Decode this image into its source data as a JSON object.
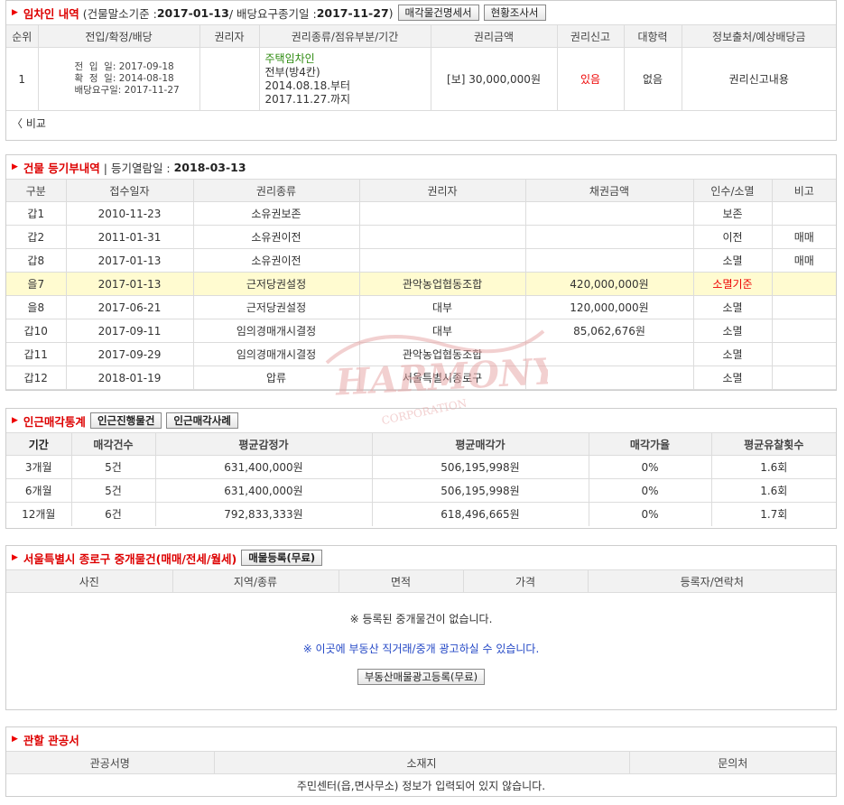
{
  "tenant": {
    "title": "임차인 내역",
    "sub_prefix": "(건물말소기준 : ",
    "base_date": "2017-01-13",
    "sub_mid": " / 배당요구종기일 : ",
    "deadline": "2017-11-27",
    "sub_suffix": ")",
    "btn1": "매각물건명세서",
    "btn2": "현황조사서",
    "headers": [
      "순위",
      "전입/확정/배당",
      "권리자",
      "권리종류/점유부분/기간",
      "권리금액",
      "권리신고",
      "대항력",
      "정보출처/예상배당금"
    ],
    "row": {
      "rank": "1",
      "dates": [
        "전  입  일: 2017-09-18",
        "확  정  일: 2014-08-18",
        "배당요구일: 2017-11-27"
      ],
      "holder": "",
      "right_type": "주택임차인",
      "right_lines": [
        "전부(방4칸)",
        "2014.08.18.부터",
        "2017.11.27.까지"
      ],
      "amount": "[보] 30,000,000원",
      "report": "있음",
      "opposing": "없음",
      "source": "권리신고내용"
    },
    "compare": "비교"
  },
  "registry": {
    "title": "건물 등기부내역",
    "sub_prefix": " | 등기열람일 : ",
    "date": "2018-03-13",
    "headers": [
      "구분",
      "접수일자",
      "권리종류",
      "권리자",
      "채권금액",
      "인수/소멸",
      "비고"
    ],
    "rows": [
      [
        "갑1",
        "2010-11-23",
        "소유권보존",
        "",
        "",
        "보존",
        ""
      ],
      [
        "갑2",
        "2011-01-31",
        "소유권이전",
        "",
        "",
        "이전",
        "매매"
      ],
      [
        "갑8",
        "2017-01-13",
        "소유권이전",
        "",
        "",
        "소멸",
        "매매"
      ],
      [
        "을7",
        "2017-01-13",
        "근저당권설정",
        "관악농업협동조합",
        "420,000,000원",
        "소멸기준",
        ""
      ],
      [
        "을8",
        "2017-06-21",
        "근저당권설정",
        "대부",
        "120,000,000원",
        "소멸",
        ""
      ],
      [
        "갑10",
        "2017-09-11",
        "임의경매개시결정",
        "대부",
        "85,062,676원",
        "소멸",
        ""
      ],
      [
        "갑11",
        "2017-09-29",
        "임의경매개시결정",
        "관악농업협동조합",
        "",
        "소멸",
        ""
      ],
      [
        "갑12",
        "2018-01-19",
        "압류",
        "서울특별시종로구",
        "",
        "소멸",
        ""
      ]
    ],
    "highlight_row": 3
  },
  "stats": {
    "title": "인근매각통계",
    "btn1": "인근진행물건",
    "btn2": "인근매각사례",
    "headers": [
      "기간",
      "매각건수",
      "평균감정가",
      "평균매각가",
      "매각가율",
      "평균유찰횟수"
    ],
    "rows": [
      [
        "3개월",
        "5건",
        "631,400,000원",
        "506,195,998원",
        "0%",
        "1.6회"
      ],
      [
        "6개월",
        "5건",
        "631,400,000원",
        "506,195,998원",
        "0%",
        "1.6회"
      ],
      [
        "12개월",
        "6건",
        "792,833,333원",
        "618,496,665원",
        "0%",
        "1.7회"
      ]
    ]
  },
  "broker": {
    "title": "서울특별시 종로구 중개물건(매매/전세/월세)",
    "btn": "매물등록(무료)",
    "headers": [
      "사진",
      "지역/종류",
      "면적",
      "가격",
      "등록자/연락처"
    ],
    "empty_msg": "※ 등록된 중개물건이 없습니다.",
    "ad_msg": "※ 이곳에 부동산 직거래/중개 광고하실 수 있습니다.",
    "ad_btn": "부동산매물광고등록(무료)"
  },
  "office": {
    "title": "관할 관공서",
    "headers": [
      "관공서명",
      "소재지",
      "문의처"
    ],
    "empty_msg": "주민센터(읍,면사무소) 정보가 입력되어 있지 않습니다."
  },
  "watermark": {
    "text": "HARMONY",
    "sub": "CORPORATION",
    "color": "#e7a3a3"
  },
  "colors": {
    "accent_red": "#e00000",
    "highlight": "#fffbd0",
    "info_blue": "#2448c6",
    "green": "#2c8a0e"
  }
}
